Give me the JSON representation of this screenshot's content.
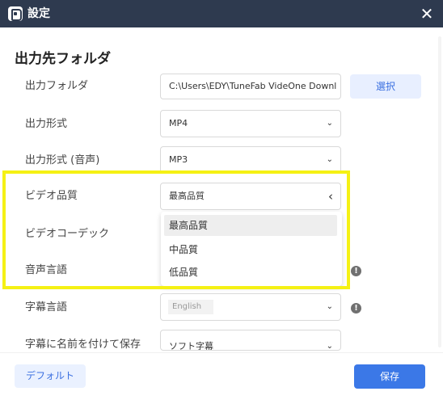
{
  "window": {
    "title": "設定",
    "close_glyph": "✕"
  },
  "section": {
    "heading": "出力先フォルダ"
  },
  "rows": {
    "output_folder": {
      "label": "出力フォルダ",
      "value": "C:\\Users\\EDY\\TuneFab VideOne Downl",
      "button": "選択"
    },
    "output_format": {
      "label": "出力形式",
      "value": "MP4"
    },
    "output_format_audio": {
      "label": "出力形式 (音声)",
      "value": "MP3"
    },
    "video_quality": {
      "label": "ビデオ品質",
      "value": "最高品質",
      "options": [
        "最高品質",
        "中品質",
        "低品質"
      ],
      "selected_index": 0
    },
    "video_codec": {
      "label": "ビデオコーデック"
    },
    "audio_language": {
      "label": "音声言語"
    },
    "subtitle_language": {
      "label": "字幕言語",
      "value": "English"
    },
    "save_subtitle_name": {
      "label": "字幕に名前を付けて保存",
      "value": "ソフト字幕"
    }
  },
  "icons": {
    "chevron_down": "⌄",
    "chevron_left": "‹",
    "info": "!"
  },
  "footer": {
    "default_label": "デフォルト",
    "save_label": "保存"
  },
  "colors": {
    "titlebar": "#2e3a4f",
    "accent": "#3b78e7",
    "highlight": "#f5f114"
  }
}
